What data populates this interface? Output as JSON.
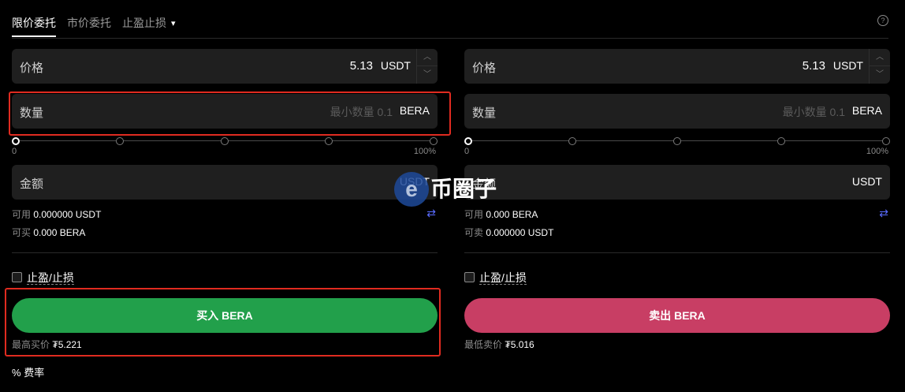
{
  "tabs": {
    "limit": "限价委托",
    "market": "市价委托",
    "tpsl": "止盈止损"
  },
  "buy": {
    "price_label": "价格",
    "price_value": "5.13",
    "price_unit": "USDT",
    "qty_label": "数量",
    "qty_placeholder": "最小数量 0.1",
    "qty_unit": "BERA",
    "slider_min": "0",
    "slider_max": "100%",
    "amount_label": "金额",
    "amount_unit": "USDT",
    "avail_label": "可用",
    "avail_value": "0.000000 USDT",
    "can_buy_label": "可买",
    "can_buy_value": "0.000 BERA",
    "tpsl_label": "止盈/止损",
    "button": "买入 BERA",
    "best_label": "最高买价",
    "best_value": "₮5.221"
  },
  "sell": {
    "price_label": "价格",
    "price_value": "5.13",
    "price_unit": "USDT",
    "qty_label": "数量",
    "qty_placeholder": "最小数量 0.1",
    "qty_unit": "BERA",
    "slider_min": "0",
    "slider_max": "100%",
    "amount_label": "金额",
    "amount_unit": "USDT",
    "avail_label": "可用",
    "avail_value": "0.000 BERA",
    "can_sell_label": "可卖",
    "can_sell_value": "0.000000 USDT",
    "tpsl_label": "止盈/止损",
    "button": "卖出 BERA",
    "best_label": "最低卖价",
    "best_value": "₮5.016"
  },
  "fee": "费率",
  "watermark": "币圈子",
  "colors": {
    "buy": "#22a04b",
    "sell": "#c83e64",
    "highlight": "#e02b20"
  }
}
